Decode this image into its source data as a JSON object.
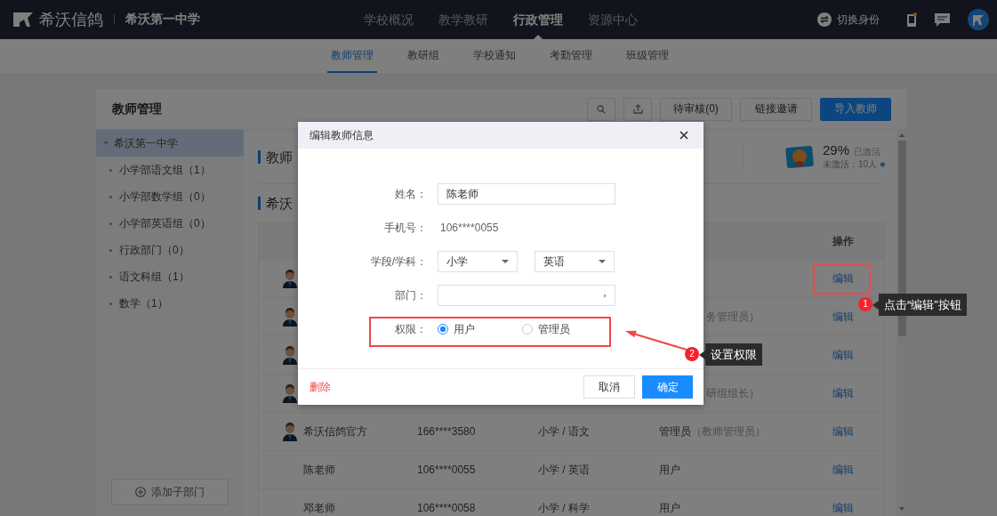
{
  "top_nav": {
    "brand": "希沃信鸽",
    "school": "希沃第一中学",
    "items": [
      {
        "label": "学校概况",
        "selected": false
      },
      {
        "label": "教学教研",
        "selected": false
      },
      {
        "label": "行政管理",
        "selected": true
      },
      {
        "label": "资源中心",
        "selected": false
      }
    ],
    "switch_identity": "切换身份"
  },
  "sub_nav": {
    "items": [
      {
        "label": "教师管理",
        "selected": true
      },
      {
        "label": "教研组",
        "selected": false
      },
      {
        "label": "学校通知",
        "selected": false
      },
      {
        "label": "考勤管理",
        "selected": false
      },
      {
        "label": "班级管理",
        "selected": false
      }
    ]
  },
  "card": {
    "title": "教师管理",
    "toolbar": [
      {
        "kind": "search"
      },
      {
        "kind": "upload"
      },
      {
        "kind": "default",
        "label": "待审核(0)"
      },
      {
        "kind": "default",
        "label": "链接邀请"
      },
      {
        "kind": "primary",
        "label": "导入教师"
      }
    ]
  },
  "tree": {
    "root": {
      "label": "希沃第一中学",
      "expanded": true,
      "selected": true,
      "children": [
        {
          "label": "小学部语文组（1）",
          "selected": false
        },
        {
          "label": "小学部数学组（0）",
          "selected": false
        },
        {
          "label": "小学部英语组（0）",
          "selected": false
        },
        {
          "label": "行政部门（0）",
          "selected": false
        },
        {
          "label": "语文科组（1）",
          "selected": false
        },
        {
          "label": "数学（1）",
          "selected": false
        }
      ]
    }
  },
  "add_department": "添加子部门",
  "stats": {
    "title": "教师",
    "percent": "29%",
    "activated": "已激活",
    "inactive": "未激活：10人"
  },
  "list_title": "希沃",
  "table": {
    "action_header": "操作",
    "rows": [
      {
        "kind": "covered",
        "avatar": true,
        "action": "编辑"
      },
      {
        "kind": "covered",
        "avatar": true,
        "role_note": "务管理员）",
        "action": "编辑"
      },
      {
        "kind": "covered",
        "avatar": true,
        "action": "编辑"
      },
      {
        "kind": "covered",
        "avatar": true,
        "role_note": "研组组长）",
        "action": "编辑"
      },
      {
        "kind": "full",
        "avatar": true,
        "name": "希沃信鸽官方",
        "phone": "166****3580",
        "subject": "小学 / 语文",
        "role": "管理员",
        "role_note": "（教师管理员）",
        "action": "编辑"
      },
      {
        "kind": "full",
        "avatar": false,
        "name": "陈老师",
        "phone": "106****0055",
        "subject": "小学 / 英语",
        "role": "用户",
        "action": "编辑"
      },
      {
        "kind": "full",
        "avatar": false,
        "name": "邓老师",
        "phone": "106****0058",
        "subject": "小学 / 科学",
        "role": "用户",
        "action": "编辑"
      }
    ]
  },
  "dialog": {
    "title": "编辑教师信息",
    "fields": [
      {
        "kind": "input",
        "label": "姓名：",
        "value": "陈老师"
      },
      {
        "kind": "text",
        "label": "手机号：",
        "value": "106****0055"
      },
      {
        "kind": "selects",
        "label": "学段/学科：",
        "values": [
          "小学",
          "英语"
        ]
      },
      {
        "kind": "cascader",
        "label": "部门："
      },
      {
        "kind": "radio",
        "label": "权限：",
        "options": [
          {
            "label": "用户",
            "selected": true
          },
          {
            "label": "管理员",
            "selected": false
          }
        ]
      }
    ],
    "delete": "删除",
    "cancel": "取消",
    "confirm": "确定"
  },
  "annotations": [
    {
      "number": "1",
      "text": "点击“编辑”按钮"
    },
    {
      "number": "2",
      "text": "设置权限"
    }
  ]
}
